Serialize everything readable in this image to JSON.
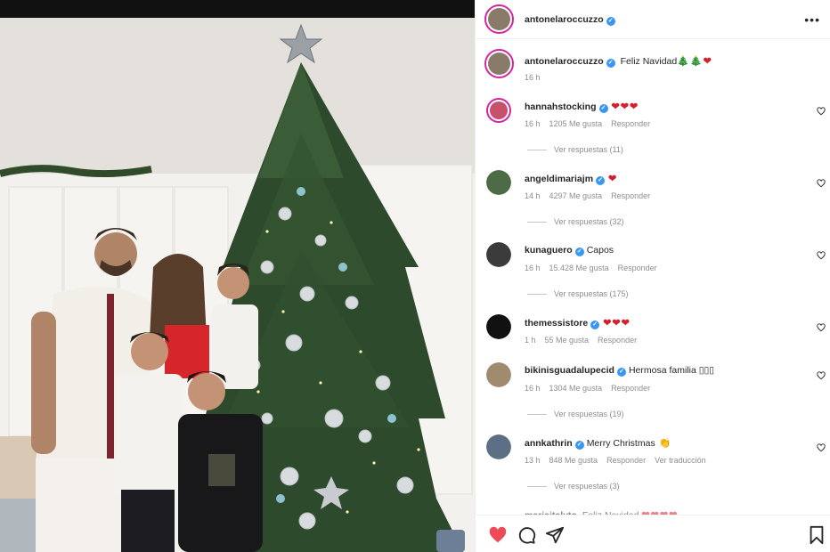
{
  "post": {
    "author": "antonelaroccuzzo",
    "caption": "Feliz Navidad",
    "caption_emoji": "🎄🎄❤",
    "time": "16 h"
  },
  "comments": [
    {
      "user": "hannahstocking",
      "text": "",
      "emoji": "❤❤❤",
      "time": "16 h",
      "likes": "1205 Me gusta",
      "reply": "Responder",
      "replies": "Ver respuestas (11)",
      "avatar_color": "#c7506b"
    },
    {
      "user": "angeldimariajm",
      "text": "",
      "emoji": "❤",
      "time": "14 h",
      "likes": "4297 Me gusta",
      "reply": "Responder",
      "replies": "Ver respuestas (32)",
      "avatar_color": "#4d6b45"
    },
    {
      "user": "kunaguero",
      "text": "Capos",
      "emoji": "",
      "time": "16 h",
      "likes": "15.428 Me gusta",
      "reply": "Responder",
      "replies": "Ver respuestas (175)",
      "avatar_color": "#3b3b3b"
    },
    {
      "user": "themessistore",
      "text": "",
      "emoji": "❤❤❤",
      "time": "1 h",
      "likes": "55 Me gusta",
      "reply": "Responder",
      "replies": "",
      "avatar_color": "#111111"
    },
    {
      "user": "bikinisguadalupecid",
      "text": "Hermosa familia ▯▯▯",
      "emoji": "",
      "time": "16 h",
      "likes": "1304 Me gusta",
      "reply": "Responder",
      "replies": "Ver respuestas (19)",
      "avatar_color": "#a08b6e"
    },
    {
      "user": "annkathrin",
      "text": "Merry Christmas",
      "emoji": "👏",
      "time": "13 h",
      "likes": "848 Me gusta",
      "reply": "Responder",
      "translate": "Ver traducción",
      "replies": "Ver respuestas (3)",
      "avatar_color": "#5c6f85"
    }
  ],
  "partial_comment": {
    "user": "mariaitalyto",
    "text": "Feliz Navidad",
    "emoji": "❤❤❤❤"
  },
  "icons": [
    "heart-filled-icon",
    "comment-icon",
    "share-icon",
    "bookmark-icon",
    "more-icon",
    "verified-icon",
    "like-outline-icon"
  ],
  "colors": {
    "like": "#ed4956",
    "verified": "#3897f0"
  }
}
